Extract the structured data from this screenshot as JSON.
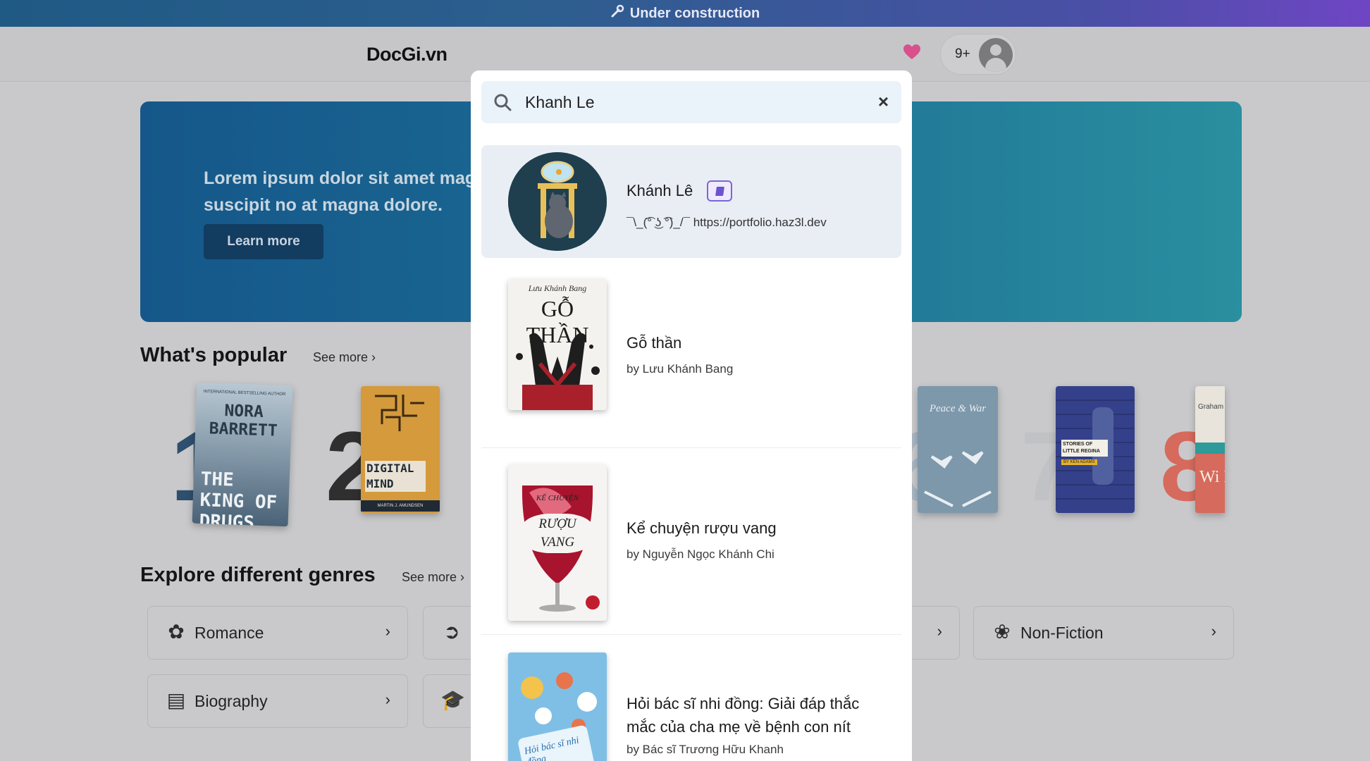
{
  "banner": {
    "text": "Under construction",
    "icon": "wrench-icon"
  },
  "header": {
    "logo": "DocGi.vn",
    "notification_count": "9+"
  },
  "hero": {
    "text": "Lorem ipsum dolor sit amet magr\nsuscipit no at magna dolore.",
    "button": "Learn more"
  },
  "popular": {
    "title": "What's popular",
    "see_more": "See more ›",
    "books": [
      {
        "rank": "1",
        "cover_title": "THE KING OF DRUGS",
        "cover_author": "NORA BARRETT",
        "cover_tag": "INTERNATIONAL BESTSELLING AUTHOR"
      },
      {
        "rank": "2",
        "cover_title": "DIGITAL MIND",
        "cover_author": "MARTIN J. AMUNDSEN"
      },
      {
        "rank": "6",
        "cover_title": "Peace & War"
      },
      {
        "rank": "7",
        "cover_title": "STORIES OF LITTLE REGINA",
        "cover_author": "BY KEN ADAMS"
      },
      {
        "rank": "8",
        "cover_title": "Wi Na",
        "cover_author": "Graham Dougla"
      }
    ]
  },
  "genres": {
    "title": "Explore different genres",
    "see_more": "See more ›",
    "items": [
      {
        "label": "Romance",
        "icon": "rose-icon"
      },
      {
        "label": "Non-Fiction",
        "icon": "brain-icon"
      },
      {
        "label": "Biography",
        "icon": "scroll-icon"
      }
    ]
  },
  "search": {
    "query": "Khanh Le",
    "placeholder": "Search",
    "results": [
      {
        "type": "user",
        "name": "Khánh Lê",
        "bio": "¯\\_(͡° ͜ʖ ͡°)_/¯ https://portfolio.haz3l.dev"
      },
      {
        "type": "book",
        "title": "Gỗ thần",
        "author": "by Lưu Khánh Bang",
        "cover_title": "GỖ THẦN",
        "cover_author": "Lưu Khánh Bang"
      },
      {
        "type": "book",
        "title": "Kể chuyện rượu vang",
        "author": "by Nguyễn Ngọc Khánh Chi",
        "cover_title": "RƯỢU VANG",
        "cover_kicker": "KỂ CHUYỆN"
      },
      {
        "type": "book",
        "title": "Hỏi bác sĩ nhi đồng: Giải đáp thắc mắc của cha mẹ về bệnh con nít",
        "author": "by Bác sĩ Trương Hữu Khanh",
        "cover_title": "Hỏi bác sĩ nhi đồng"
      }
    ]
  },
  "colors": {
    "accent": "#6b54cf",
    "heart": "#d9508c",
    "hero_start": "#15578a",
    "hero_end": "#2a8f9f"
  }
}
